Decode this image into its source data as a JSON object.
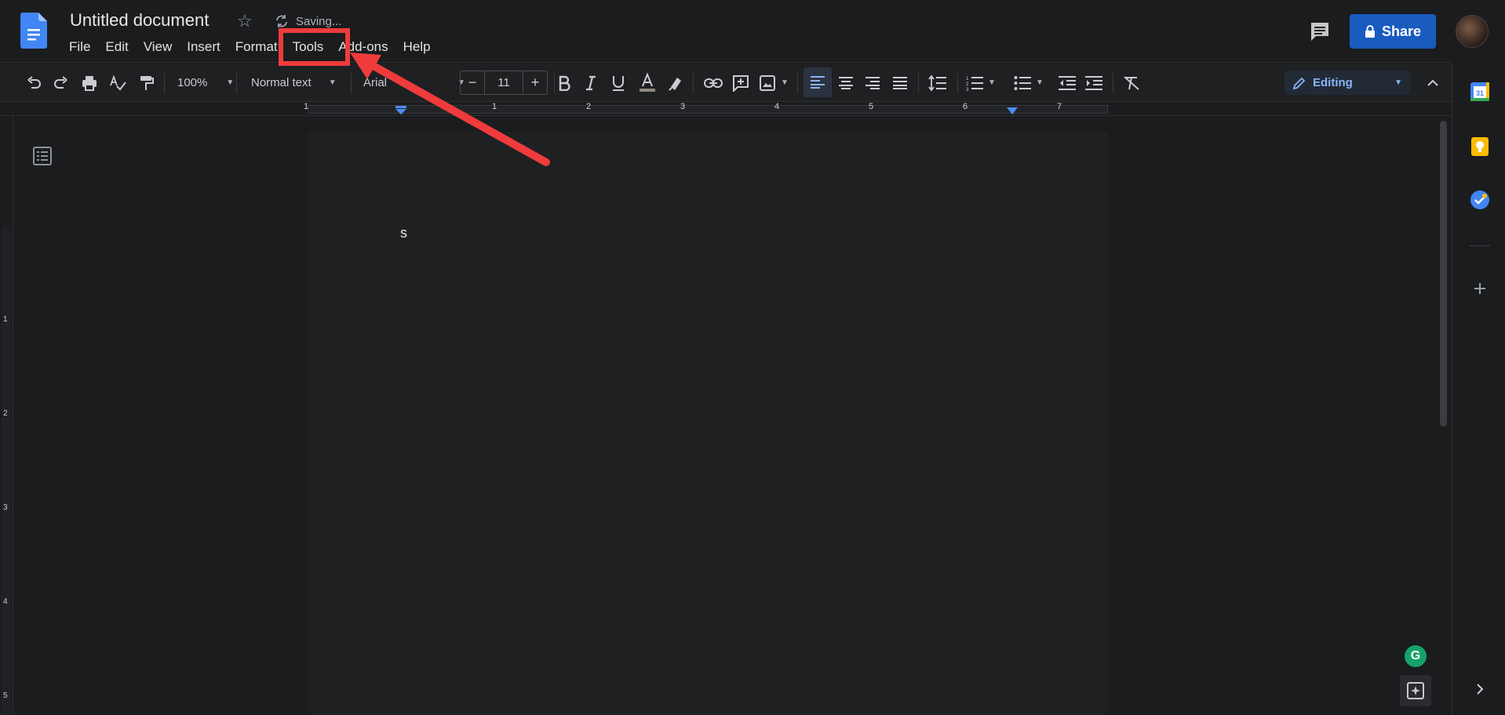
{
  "document": {
    "title": "Untitled document",
    "save_status": "Saving...",
    "body_text": "s"
  },
  "menu": {
    "items": [
      "File",
      "Edit",
      "View",
      "Insert",
      "Format",
      "Tools",
      "Add-ons",
      "Help"
    ]
  },
  "header": {
    "share_label": "Share"
  },
  "toolbar": {
    "zoom": "100%",
    "style": "Normal text",
    "font": "Arial",
    "font_size": "11",
    "editing_mode": "Editing"
  },
  "ruler": {
    "numbers": [
      "1",
      "1",
      "2",
      "3",
      "4",
      "5",
      "6",
      "7"
    ],
    "vertical_numbers": [
      "1",
      "2",
      "3",
      "4",
      "5"
    ]
  },
  "sidepanel": {
    "calendar_day": "31"
  },
  "grammarly": {
    "letter": "G"
  },
  "colors": {
    "accent_blue": "#1a5bc0",
    "annotation_red": "#ef3b3b",
    "editing_blue": "#8ab4f8"
  }
}
